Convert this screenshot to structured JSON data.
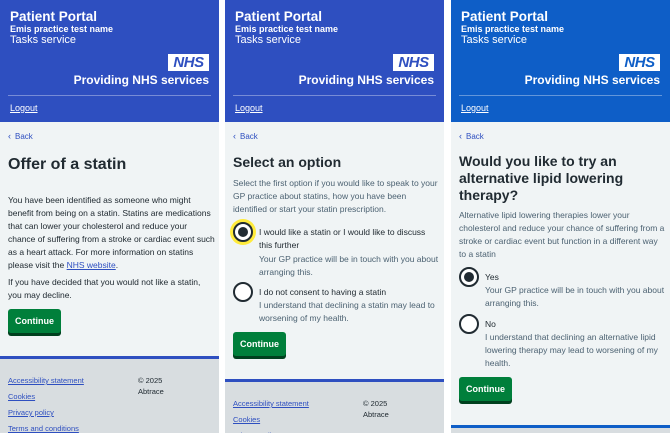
{
  "header": {
    "brand": "Patient Portal",
    "practice": "Emis practice test name",
    "service": "Tasks service",
    "nhs_logo": "NHS",
    "providing": "Providing NHS services",
    "logout": "Logout"
  },
  "back_label": "Back",
  "continue_label": "Continue",
  "panel1": {
    "title": "Offer of a statin",
    "paragraph1": "You have been identified as someone who might benefit from being on a statin. Statins are medications that can lower your cholesterol and reduce your chance of suffering from a stroke or cardiac event such as a heart attack. For more information on statins please visit the",
    "link": "NHS website",
    "paragraph1_end": ".",
    "paragraph2": "If you have decided that you would not like a statin, you may decline."
  },
  "panel2": {
    "title": "Select an option",
    "hint": "Select the first option if you would like to speak to your GP practice about statins, how you have been identified or start your statin prescription.",
    "options": [
      {
        "label": "I would like a statin or I would like to discuss this further",
        "hint": "Your GP practice will be in touch with you about arranging this.",
        "selected": true
      },
      {
        "label": "I do not consent to having a statin",
        "hint": "I understand that declining a statin may lead to worsening of my health.",
        "selected": false
      }
    ]
  },
  "panel3": {
    "title": "Would you like to try an alternative lipid lowering therapy?",
    "hint": "Alternative lipid lowering therapies lower your cholesterol and reduce your chance of suffering from a stroke or cardiac event but function in a different way to a statin",
    "options": [
      {
        "label": "Yes",
        "hint": "Your GP practice will be in touch with you about arranging this.",
        "selected": true
      },
      {
        "label": "No",
        "hint": "I understand that declining an alternative lipid lowering therapy may lead to worsening of my health.",
        "selected": false
      }
    ]
  },
  "footer": {
    "links": [
      "Accessibility statement",
      "Cookies",
      "Privacy policy",
      "Terms and conditions"
    ],
    "copyright_year": "© 2025",
    "copyright_owner": "Abtrace"
  },
  "colors": {
    "nhs_blue": "#2e4fc0",
    "nhs_blue_bright": "#0e5ec7",
    "button_green": "#007f3b",
    "focus_yellow": "#ffeb3b"
  }
}
